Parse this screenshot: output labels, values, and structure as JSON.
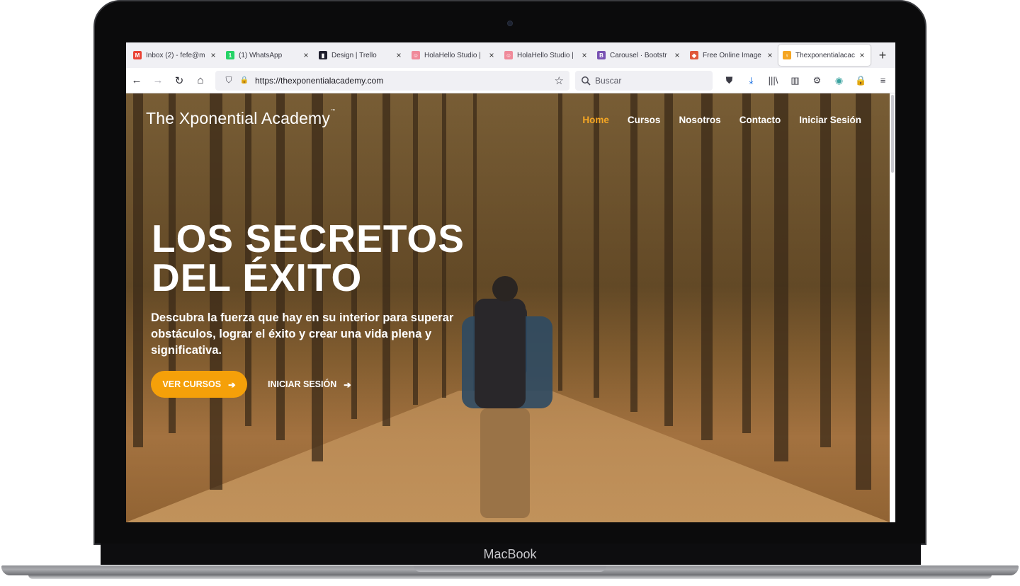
{
  "device": {
    "brand_label": "MacBook"
  },
  "browser": {
    "tabs": [
      {
        "title": "Inbox (2) - fefe@m",
        "icon": "gmail-icon",
        "icon_glyph": "M",
        "icon_color": "#ea4335"
      },
      {
        "title": "(1) WhatsApp",
        "icon": "whatsapp-icon",
        "icon_glyph": "1",
        "icon_color": "#25d366"
      },
      {
        "title": "Design | Trello",
        "icon": "trello-icon",
        "icon_glyph": "▮",
        "icon_color": "#1f1f2e"
      },
      {
        "title": "HolaHello Studio | ",
        "icon": "holahello-icon",
        "icon_glyph": "☺",
        "icon_color": "#f08a9a"
      },
      {
        "title": "HolaHello Studio | ",
        "icon": "holahello-icon",
        "icon_glyph": "☺",
        "icon_color": "#f08a9a"
      },
      {
        "title": "Carousel · Bootstr",
        "icon": "bootstrap-icon",
        "icon_glyph": "B",
        "icon_color": "#7952b3"
      },
      {
        "title": "Free Online Image",
        "icon": "image-tool-icon",
        "icon_glyph": "◆",
        "icon_color": "#e0573a"
      },
      {
        "title": "Thexponentialacac",
        "icon": "lightbulb-icon",
        "icon_glyph": "♀",
        "icon_color": "#f5a623",
        "active": true
      }
    ],
    "close_glyph": "×",
    "new_tab_glyph": "+",
    "url": "https://thexponentialacademy.com",
    "search_placeholder": "Buscar",
    "nav_icons": {
      "back": "←",
      "forward": "→",
      "reload": "↻",
      "home": "⌂",
      "shield": "⛉",
      "lock": "🔒",
      "star": "☆"
    },
    "toolbar_icons": [
      {
        "name": "pocket-icon",
        "glyph": "⛊"
      },
      {
        "name": "download-icon",
        "glyph": "⤓",
        "color": "#0060df"
      },
      {
        "name": "library-icon",
        "glyph": "|||\\"
      },
      {
        "name": "sidebar-icon",
        "glyph": "▥"
      },
      {
        "name": "extension-gear-icon",
        "glyph": "⚙"
      },
      {
        "name": "extension-globe-icon",
        "glyph": "◉",
        "color": "#3aa3a0"
      },
      {
        "name": "extension-lock-icon",
        "glyph": "🔒",
        "color": "#e0342b"
      },
      {
        "name": "hamburger-menu-icon",
        "glyph": "≡"
      }
    ]
  },
  "site": {
    "logo": "The Xponential Academy",
    "logo_tm": "™",
    "menu": [
      {
        "label": "Home",
        "active": true
      },
      {
        "label": "Cursos"
      },
      {
        "label": "Nosotros"
      },
      {
        "label": "Contacto"
      },
      {
        "label": "Iniciar Sesión"
      }
    ],
    "hero": {
      "title_line1": "LOS SECRETOS",
      "title_line2": "DEL ÉXITO",
      "subtitle": "Descubra la fuerza que hay en su interior para superar obstáculos, lograr el éxito y crear una vida plena y significativa.",
      "primary_cta": "VER CURSOS",
      "secondary_cta": "INICIAR SESIÓN",
      "arrow": "➔"
    },
    "accent_color": "#f5a009"
  }
}
